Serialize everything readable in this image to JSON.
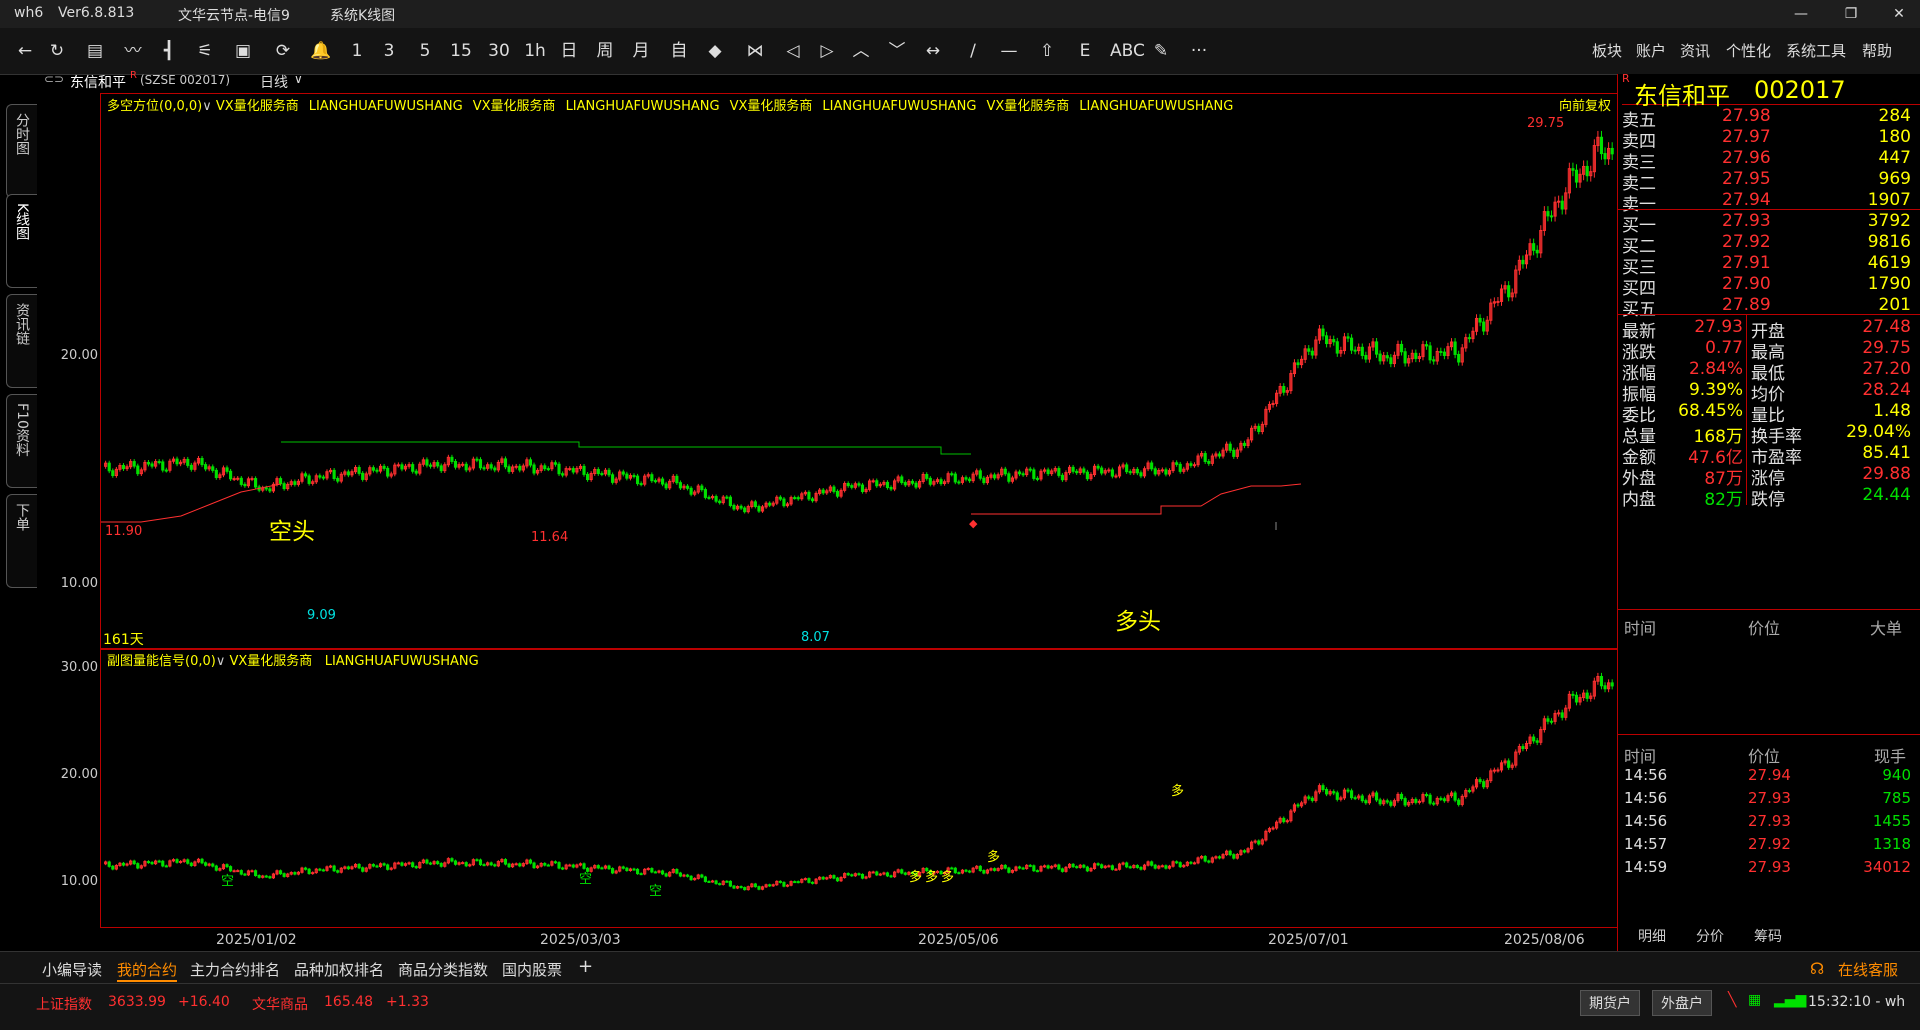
{
  "titlebar": {
    "app": "wh6",
    "version": "Ver6.8.813",
    "server": "文华云节点-电信9",
    "view": "系统K线图"
  },
  "window_controls": {
    "minimize": "—",
    "maximize": "❐",
    "close": "✕"
  },
  "toolbar": {
    "items": [
      "←",
      "↻",
      "▤",
      "〰",
      "┫",
      "⚟",
      "▣",
      "⟳",
      "🔔",
      "1",
      "3",
      "5",
      "15",
      "30",
      "1h",
      "日",
      "周",
      "月",
      "自",
      "◆",
      "⋈",
      "◁",
      "▷",
      "︿",
      "﹀",
      "↔",
      "∕",
      "—",
      "⇧",
      "E",
      "ABC",
      "✎",
      "···"
    ],
    "right_menu": [
      "板块",
      "账户",
      "资讯",
      "个性化",
      "系统工具",
      "帮助"
    ]
  },
  "left_tabs": [
    "分时图",
    "K线图",
    "资讯链",
    "F10资料",
    "下单"
  ],
  "chart_header": {
    "symbol": "东信和平",
    "flag": "R",
    "code": "(SZSE 002017)",
    "period": "日线"
  },
  "main_chart": {
    "indicator": "多空方位(0,0,0)",
    "labels": [
      "VX量化服务商",
      "LIANGHUAFUWUSHANG",
      "VX量化服务商",
      "LIANGHUAFUWUSHANG",
      "VX量化服务商",
      "LIANGHUAFUWUSHANG",
      "VX量化服务商",
      "LIANGHUAFUWUSHANG"
    ],
    "adjust": "向前复权",
    "y_ticks": [
      "20.00",
      "10.00"
    ],
    "annotations": {
      "high_left": "11.90",
      "mid_high": "11.64",
      "low1": "9.09",
      "low2": "8.07",
      "top": "29.75",
      "days": "161天",
      "short": "空头",
      "long": "多头"
    }
  },
  "sub_chart": {
    "indicator": "副图量能信号(0,0)",
    "label1": "VX量化服务商",
    "label2": "LIANGHUAFUWUSHANG",
    "y_ticks": [
      "30.00",
      "20.00",
      "10.00"
    ],
    "signals": [
      "空",
      "空",
      "空",
      "多",
      "多",
      "多",
      "多",
      "多"
    ]
  },
  "dates": [
    "2025/01/02",
    "2025/03/03",
    "2025/05/06",
    "2025/07/01",
    "2025/08/06"
  ],
  "quote": {
    "name": "东信和平",
    "code": "002017",
    "flag": "R",
    "asks": [
      {
        "label": "卖五",
        "price": "27.98",
        "vol": "284"
      },
      {
        "label": "卖四",
        "price": "27.97",
        "vol": "180"
      },
      {
        "label": "卖三",
        "price": "27.96",
        "vol": "447"
      },
      {
        "label": "卖二",
        "price": "27.95",
        "vol": "969"
      },
      {
        "label": "卖一",
        "price": "27.94",
        "vol": "1907"
      }
    ],
    "bids": [
      {
        "label": "买一",
        "price": "27.93",
        "vol": "3792"
      },
      {
        "label": "买二",
        "price": "27.92",
        "vol": "9816"
      },
      {
        "label": "买三",
        "price": "27.91",
        "vol": "4619"
      },
      {
        "label": "买四",
        "price": "27.90",
        "vol": "1790"
      },
      {
        "label": "买五",
        "price": "27.89",
        "vol": "201"
      }
    ],
    "stats": [
      {
        "l1": "最新",
        "v1": "27.93",
        "c1": "red",
        "l2": "开盘",
        "v2": "27.48",
        "c2": "red"
      },
      {
        "l1": "涨跌",
        "v1": "0.77",
        "c1": "red",
        "l2": "最高",
        "v2": "29.75",
        "c2": "red"
      },
      {
        "l1": "涨幅",
        "v1": "2.84%",
        "c1": "red",
        "l2": "最低",
        "v2": "27.20",
        "c2": "red"
      },
      {
        "l1": "振幅",
        "v1": "9.39%",
        "c1": "yellow",
        "l2": "均价",
        "v2": "28.24",
        "c2": "red"
      },
      {
        "l1": "委比",
        "v1": "68.45%",
        "c1": "yellow",
        "l2": "量比",
        "v2": "1.48",
        "c2": "yellow"
      },
      {
        "l1": "总量",
        "v1": "168万",
        "c1": "yellow",
        "l2": "换手率",
        "v2": "29.04%",
        "c2": "yellow"
      },
      {
        "l1": "金额",
        "v1": "47.6亿",
        "c1": "red",
        "l2": "市盈率",
        "v2": "85.41",
        "c2": "yellow"
      },
      {
        "l1": "外盘",
        "v1": "87万",
        "c1": "red",
        "l2": "涨停",
        "v2": "29.88",
        "c2": "red"
      },
      {
        "l1": "内盘",
        "v1": "82万",
        "c1": "green",
        "l2": "跌停",
        "v2": "24.44",
        "c2": "green"
      }
    ],
    "big_head": {
      "time": "时间",
      "price": "价位",
      "big": "大单"
    },
    "tick_head": {
      "time": "时间",
      "price": "价位",
      "vol": "现手"
    },
    "ticks": [
      {
        "time": "14:56",
        "price": "27.94",
        "vol": "940"
      },
      {
        "time": "14:56",
        "price": "27.93",
        "vol": "785"
      },
      {
        "time": "14:56",
        "price": "27.93",
        "vol": "1455"
      },
      {
        "time": "14:57",
        "price": "27.92",
        "vol": "1318"
      },
      {
        "time": "14:59",
        "price": "27.93",
        "vol": "34012"
      }
    ],
    "bottom_tabs": [
      "明细",
      "分价",
      "筹码"
    ]
  },
  "bottom_tabs": [
    "小编导读",
    "我的合约",
    "主力合约排名",
    "品种加权排名",
    "商品分类指数",
    "国内股票",
    "+"
  ],
  "service": "在线客服",
  "status": {
    "idx1_name": "上证指数",
    "idx1_val": "3633.99",
    "idx1_chg": "+16.40",
    "idx2_name": "文华商品",
    "idx2_val": "165.48",
    "idx2_chg": "+1.33",
    "btn1": "期货户",
    "btn2": "外盘户",
    "time": "15:32:10 - wh"
  },
  "colors": {
    "up": "#ff3030",
    "down": "#00e000",
    "border": "#b00000",
    "label": "#ffff00"
  }
}
